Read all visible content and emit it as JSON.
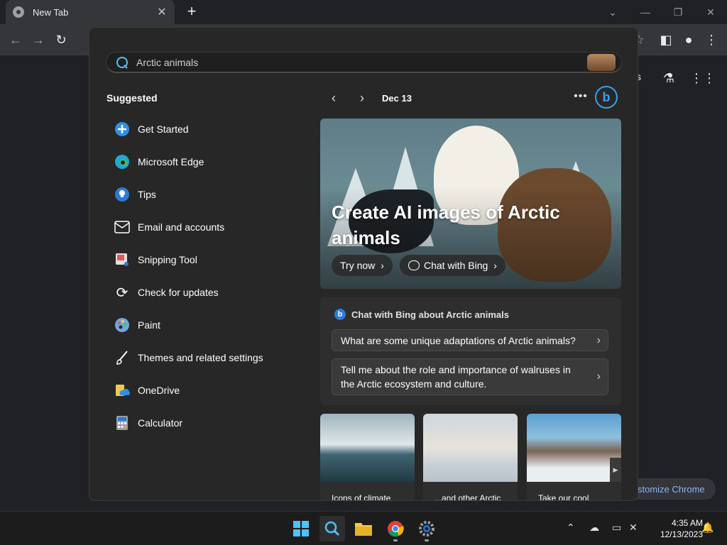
{
  "browser": {
    "tab_title": "New Tab",
    "page_partial_text": "s",
    "customize_label": "stomize Chrome"
  },
  "search": {
    "query": "Arctic animals"
  },
  "suggested": {
    "title": "Suggested",
    "items": [
      {
        "label": "Get Started",
        "icon": "get-started-icon"
      },
      {
        "label": "Microsoft Edge",
        "icon": "edge-icon"
      },
      {
        "label": "Tips",
        "icon": "tips-icon"
      },
      {
        "label": "Email and accounts",
        "icon": "mail-icon"
      },
      {
        "label": "Snipping Tool",
        "icon": "snipping-tool-icon"
      },
      {
        "label": "Check for updates",
        "icon": "refresh-icon"
      },
      {
        "label": "Paint",
        "icon": "paint-icon"
      },
      {
        "label": "Themes and related settings",
        "icon": "brush-icon"
      },
      {
        "label": "OneDrive",
        "icon": "onedrive-icon"
      },
      {
        "label": "Calculator",
        "icon": "calculator-icon"
      }
    ]
  },
  "highlights": {
    "date": "Dec 13",
    "hero_title": "Create AI images of Arctic animals",
    "try_now": "Try now",
    "chat_with_bing": "Chat with Bing"
  },
  "chat_card": {
    "title": "Chat with Bing about Arctic animals",
    "prompts": [
      "What are some unique adaptations of Arctic animals?",
      "Tell me about the role and importance of walruses in the Arctic ecosystem and culture."
    ]
  },
  "thumbnails": [
    {
      "caption": "Icons of climate"
    },
    {
      "caption": "...and other Arctic"
    },
    {
      "caption": "Take our cool"
    }
  ],
  "taskbar": {
    "time": "4:35 AM",
    "date": "12/13/2023"
  }
}
